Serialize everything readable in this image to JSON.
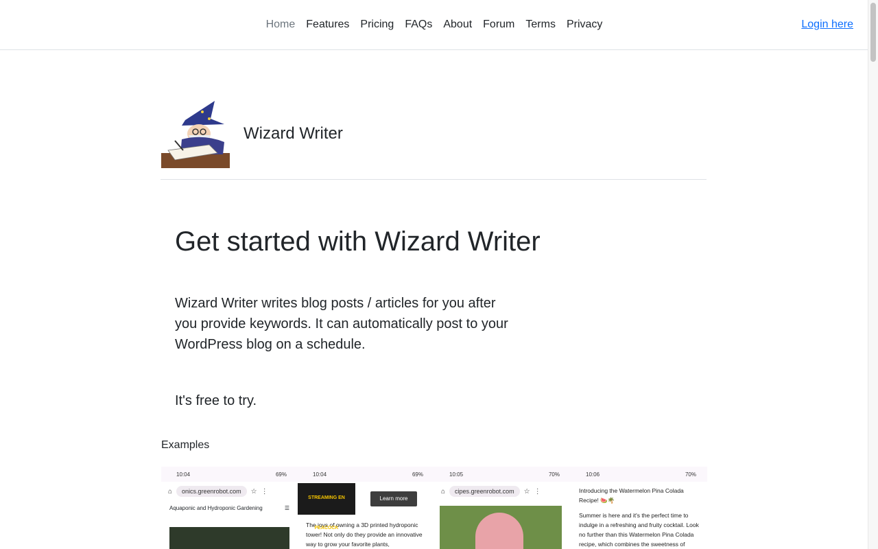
{
  "nav": {
    "items": [
      "Home",
      "Features",
      "Pricing",
      "FAQs",
      "About",
      "Forum",
      "Terms",
      "Privacy"
    ],
    "active": "Home",
    "login": "Login here"
  },
  "brand": {
    "name": "Wizard Writer",
    "logo": "wizard-writing-logo"
  },
  "hero": {
    "title": "Get started with Wizard Writer",
    "description": "Wizard Writer writes blog posts / articles for you after you provide keywords. It can automatically post to your WordPress blog on a schedule.",
    "free": "It's free to try."
  },
  "examples": {
    "label": "Examples",
    "shots": [
      {
        "time": "10:04",
        "battery": "69%",
        "url": "onics.greenrobot.com",
        "title": "Aquaponic and Hydroponic Gardening"
      },
      {
        "time": "10:04",
        "battery": "69%",
        "ad_text": "STREAMING EN PEACOCK",
        "ad_button": "Learn more",
        "body": "The joys of owning a 3D printed hydroponic tower! Not only do they provide an innovative way to grow your favorite plants,"
      },
      {
        "time": "10:05",
        "battery": "70%",
        "url": "cipes.greenrobot.com"
      },
      {
        "time": "10:06",
        "battery": "70%",
        "heading": "Introducing the Watermelon Pina Colada Recipe! 🍉🌴",
        "body": "Summer is here and it's the perfect time to indulge in a refreshing and fruity cocktail. Look no further than this Watermelon Pina Colada recipe, which combines the sweetness of watermelon with the"
      }
    ]
  },
  "colors": {
    "link": "#0d6efd",
    "text": "#212529",
    "muted": "#6c757d",
    "border": "#dee2e6"
  }
}
